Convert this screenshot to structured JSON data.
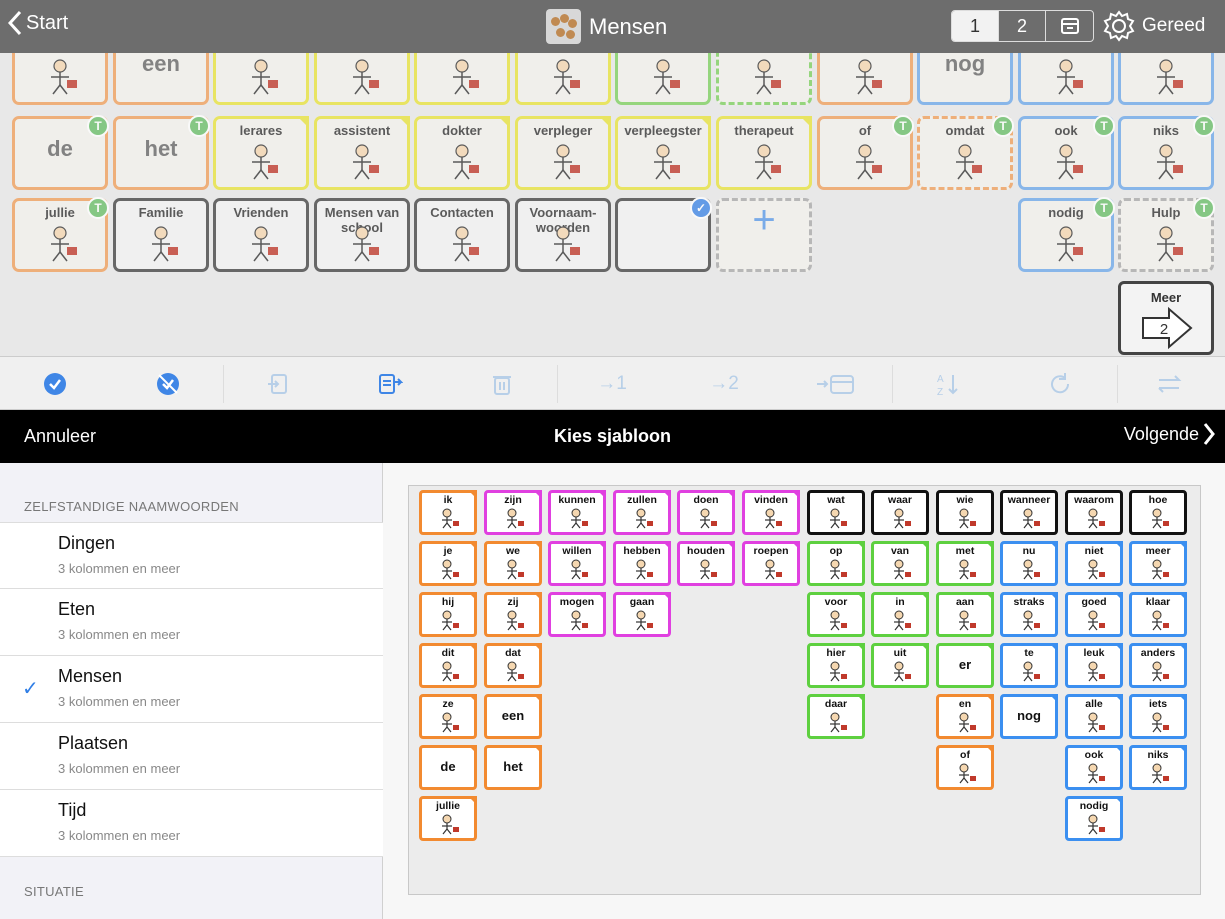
{
  "topbar": {
    "back_label": "Start",
    "title": "Mensen",
    "seg1": "1",
    "seg2": "2",
    "done_label": "Gereed"
  },
  "grid_row0": [
    "",
    "een",
    "",
    "",
    "",
    "",
    "",
    "",
    "",
    "nog",
    "",
    ""
  ],
  "grid_row1": [
    {
      "label": "de",
      "big": true,
      "color": "or",
      "badge": true
    },
    {
      "label": "het",
      "big": true,
      "color": "or",
      "badge": true
    },
    {
      "label": "lerares",
      "color": "ye"
    },
    {
      "label": "assistent",
      "color": "ye"
    },
    {
      "label": "dokter",
      "color": "ye"
    },
    {
      "label": "verpleger",
      "color": "ye"
    },
    {
      "label": "verpleegster",
      "color": "ye"
    },
    {
      "label": "therapeut",
      "color": "ye"
    },
    {
      "label": "of",
      "color": "or",
      "badge": true
    },
    {
      "label": "omdat",
      "color": "or",
      "badge": true,
      "dashed": true
    },
    {
      "label": "ook",
      "color": "bl",
      "badge": true
    },
    {
      "label": "niks",
      "color": "bl",
      "badge": true
    }
  ],
  "grid_row2": [
    {
      "label": "jullie",
      "color": "or",
      "badge": true
    },
    {
      "label": "Familie",
      "color": "dk"
    },
    {
      "label": "Vrienden",
      "color": "dk"
    },
    {
      "label": "Mensen van school",
      "color": "dk"
    },
    {
      "label": "Contacten",
      "color": "dk"
    },
    {
      "label": "Voornaam-woorden",
      "color": "dk"
    },
    {
      "label": "",
      "color": "dk",
      "check": true
    },
    {
      "label": "+",
      "color": "ga",
      "dashed": true
    },
    null,
    null,
    {
      "label": "nodig",
      "color": "bl",
      "badge": true
    },
    {
      "label": "Hulp",
      "color": "ga",
      "badge": true,
      "dashed": true
    }
  ],
  "more": {
    "label": "Meer",
    "page": "2"
  },
  "modal": {
    "cancel": "Annuleer",
    "title": "Kies sjabloon",
    "next": "Volgende"
  },
  "sidebar": {
    "section1": "ZELFSTANDIGE NAAMWOORDEN",
    "section2": "SITUATIE",
    "options": [
      {
        "name": "Dingen",
        "sub": "3 kolommen en meer",
        "selected": false
      },
      {
        "name": "Eten",
        "sub": "3 kolommen en meer",
        "selected": false
      },
      {
        "name": "Mensen",
        "sub": "3 kolommen en meer",
        "selected": true
      },
      {
        "name": "Plaatsen",
        "sub": "3 kolommen en meer",
        "selected": false
      },
      {
        "name": "Tijd",
        "sub": "3 kolommen en meer",
        "selected": false
      }
    ]
  },
  "preview": [
    [
      [
        "ik",
        "or"
      ],
      [
        "zijn",
        "pk"
      ],
      [
        "kunnen",
        "pk"
      ],
      [
        "zullen",
        "pk"
      ],
      [
        "doen",
        "pk"
      ],
      [
        "vinden",
        "pk"
      ],
      [
        "wat",
        "bk"
      ],
      [
        "waar",
        "bk"
      ],
      [
        "wie",
        "bk"
      ],
      [
        "wanneer",
        "bk"
      ],
      [
        "waarom",
        "bk"
      ],
      [
        "hoe",
        "bk"
      ]
    ],
    [
      [
        "je",
        "or"
      ],
      [
        "we",
        "or"
      ],
      [
        "willen",
        "pk"
      ],
      [
        "hebben",
        "pk"
      ],
      [
        "houden",
        "pk"
      ],
      [
        "roepen",
        "pk"
      ],
      [
        "op",
        "gr"
      ],
      [
        "van",
        "gr"
      ],
      [
        "met",
        "gr"
      ],
      [
        "nu",
        "bl"
      ],
      [
        "niet",
        "bl"
      ],
      [
        "meer",
        "bl"
      ]
    ],
    [
      [
        "hij",
        "or"
      ],
      [
        "zij",
        "or"
      ],
      [
        "mogen",
        "pk"
      ],
      [
        "gaan",
        "pk"
      ],
      null,
      null,
      [
        "voor",
        "gr"
      ],
      [
        "in",
        "gr"
      ],
      [
        "aan",
        "gr"
      ],
      [
        "straks",
        "bl"
      ],
      [
        "goed",
        "bl"
      ],
      [
        "klaar",
        "bl"
      ]
    ],
    [
      [
        "dit",
        "or"
      ],
      [
        "dat",
        "or"
      ],
      null,
      null,
      null,
      null,
      [
        "hier",
        "gr"
      ],
      [
        "uit",
        "gr"
      ],
      [
        "er",
        "gr",
        "mid"
      ],
      [
        "te",
        "bl"
      ],
      [
        "leuk",
        "bl"
      ],
      [
        "anders",
        "bl"
      ]
    ],
    [
      [
        "ze",
        "or"
      ],
      [
        "een",
        "or",
        "mid"
      ],
      null,
      null,
      null,
      null,
      [
        "daar",
        "gr"
      ],
      null,
      [
        "en",
        "or"
      ],
      [
        "nog",
        "bl",
        "mid"
      ],
      [
        "alle",
        "bl"
      ],
      [
        "iets",
        "bl"
      ]
    ],
    [
      [
        "de",
        "or",
        "mid"
      ],
      [
        "het",
        "or",
        "mid"
      ],
      null,
      null,
      null,
      null,
      null,
      null,
      [
        "of",
        "or"
      ],
      null,
      [
        "ook",
        "bl"
      ],
      [
        "niks",
        "bl"
      ]
    ],
    [
      [
        "jullie",
        "or"
      ],
      null,
      null,
      null,
      null,
      null,
      null,
      null,
      null,
      null,
      [
        "nodig",
        "bl"
      ],
      null
    ]
  ]
}
